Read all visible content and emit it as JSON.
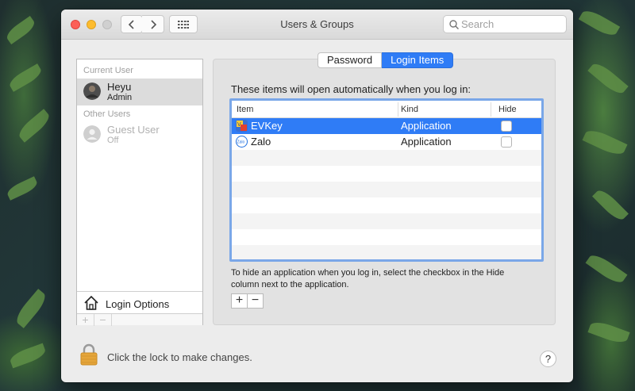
{
  "window": {
    "title": "Users & Groups",
    "search_placeholder": "Search"
  },
  "sidebar": {
    "current_user_header": "Current User",
    "current_user": {
      "name": "Heyu",
      "role": "Admin"
    },
    "other_users_header": "Other Users",
    "other_users": [
      {
        "name": "Guest User",
        "status": "Off"
      }
    ],
    "login_options_label": "Login Options",
    "add_symbol": "+",
    "remove_symbol": "−"
  },
  "tabs": [
    {
      "label": "Password",
      "active": false
    },
    {
      "label": "Login Items",
      "active": true
    }
  ],
  "main": {
    "intro": "These items will open automatically when you log in:",
    "columns": {
      "item": "Item",
      "kind": "Kind",
      "hide": "Hide"
    },
    "items": [
      {
        "name": "EVKey",
        "kind": "Application",
        "hide": false,
        "selected": true
      },
      {
        "name": "Zalo",
        "kind": "Application",
        "hide": false,
        "selected": false
      }
    ],
    "hint": "To hide an application when you log in, select the checkbox in the Hide column next to the application.",
    "add_symbol": "+",
    "remove_symbol": "−"
  },
  "footer": {
    "lock_text": "Click the lock to make changes.",
    "help_symbol": "?"
  },
  "colors": {
    "accent": "#2f7cf6",
    "traffic_red": "#fc5f57",
    "traffic_yellow": "#fdbc2e",
    "lock": "#e5a53a"
  },
  "icons": {
    "zalo_icon_text": "Zalo"
  }
}
